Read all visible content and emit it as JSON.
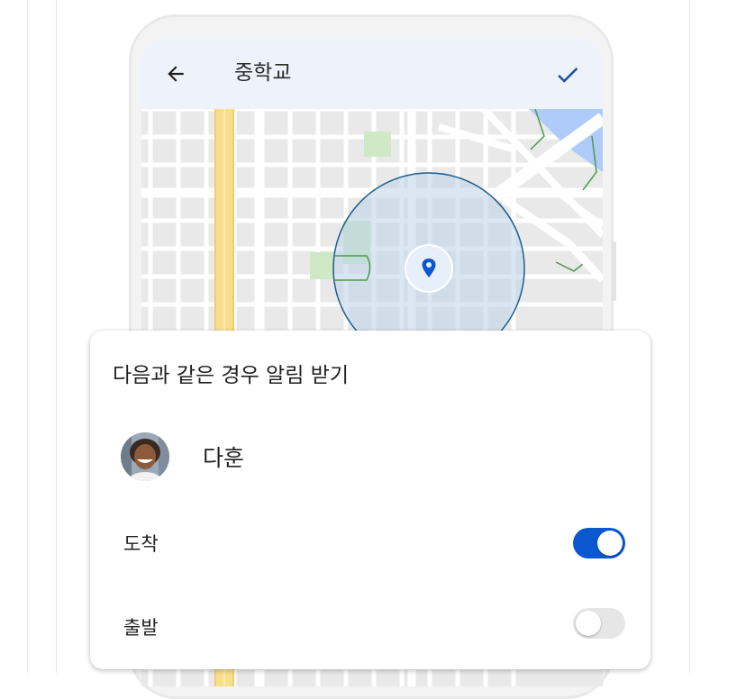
{
  "app_bar": {
    "title": "중학교"
  },
  "map": {
    "pin_icon": "location-pin-icon"
  },
  "sheet": {
    "title": "다음과 같은 경우 알림 받기",
    "person": {
      "name": "다훈"
    },
    "arrive": {
      "label": "도착",
      "enabled": true
    },
    "depart": {
      "label": "출발",
      "enabled": false
    }
  },
  "colors": {
    "accent": "#0b57d0",
    "app_bar_bg": "#eef2fb",
    "geofence_stroke": "#1b5e8e"
  }
}
